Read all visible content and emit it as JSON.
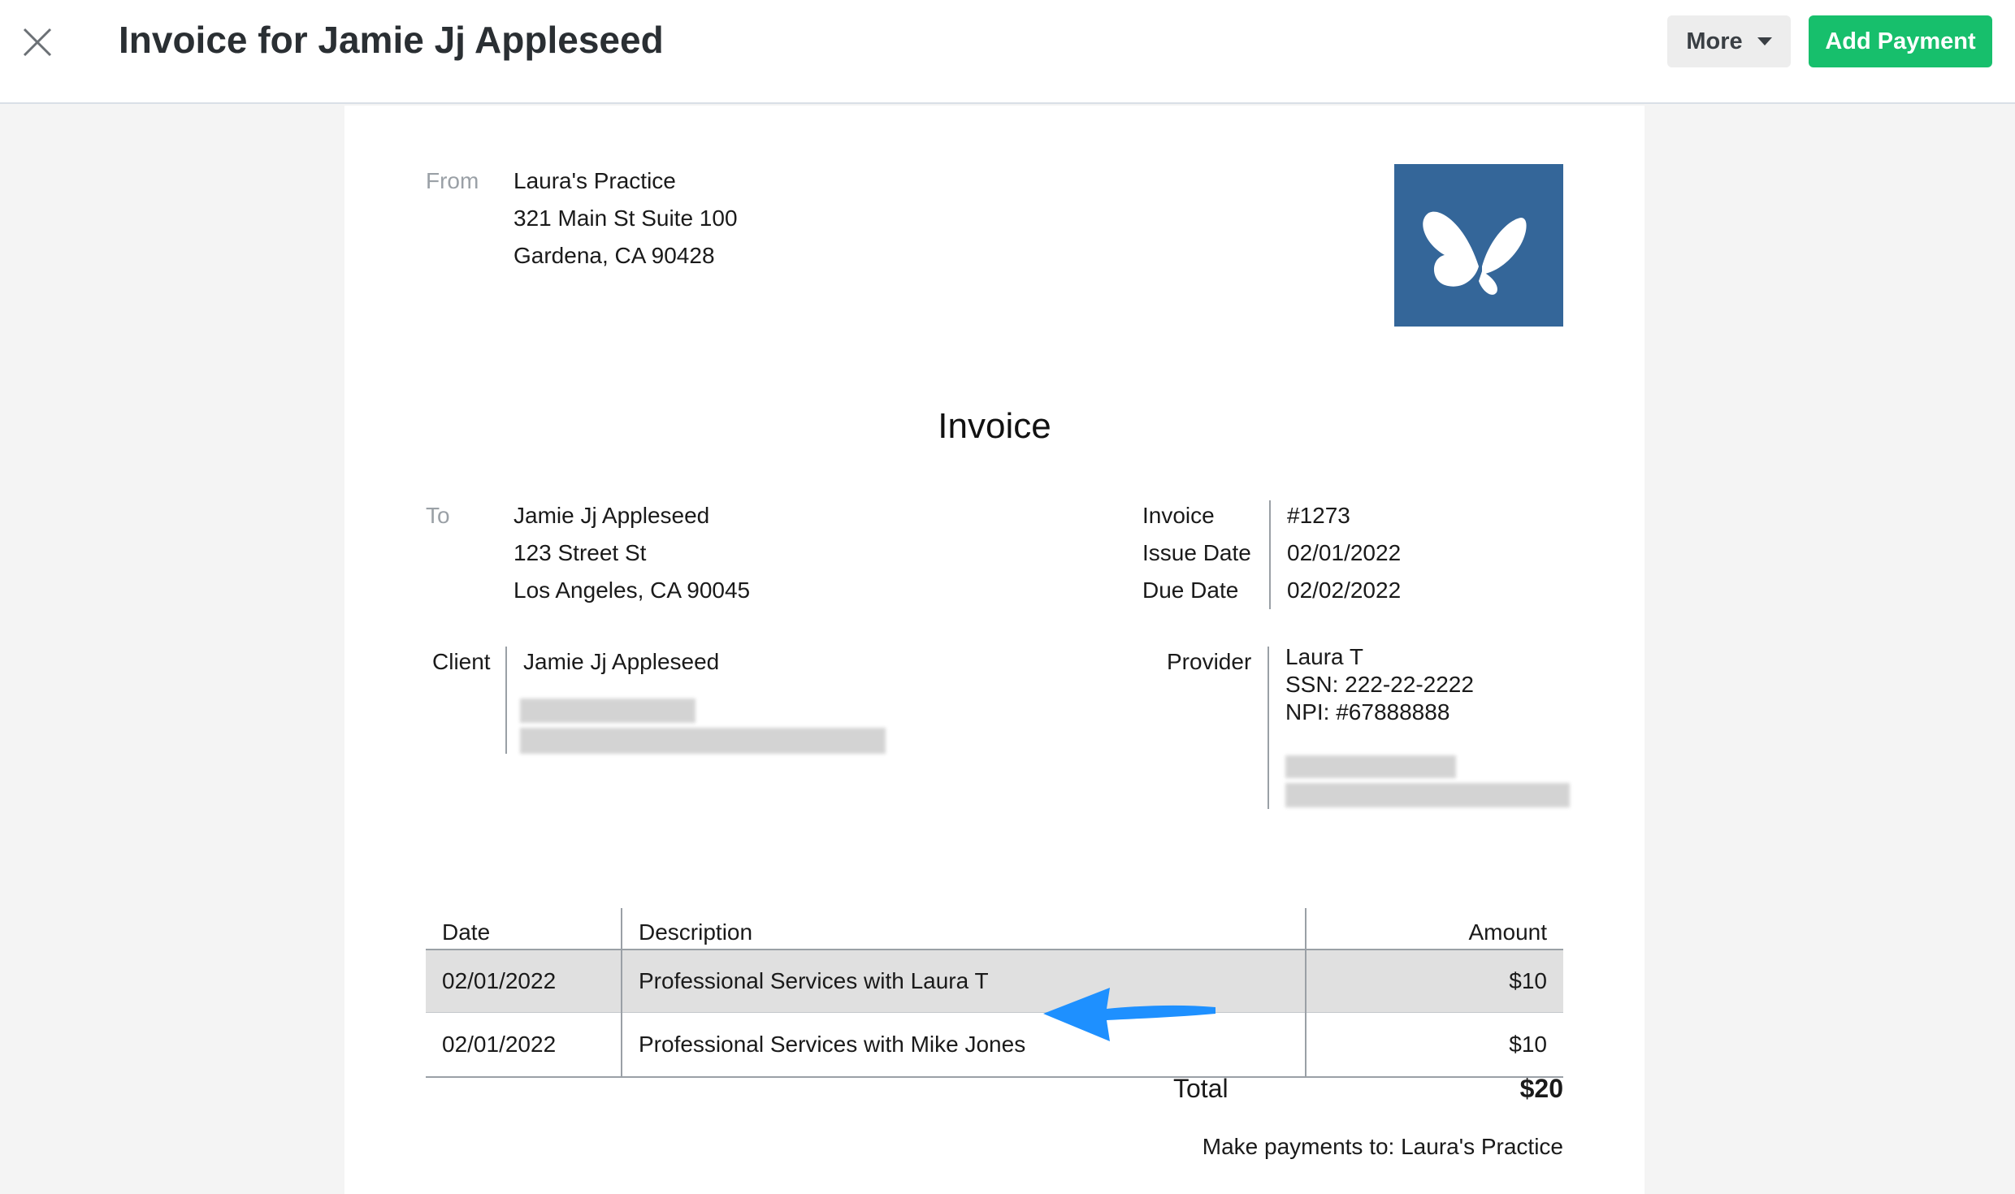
{
  "header": {
    "title": "Invoice for Jamie Jj Appleseed",
    "more_label": "More",
    "add_payment_label": "Add Payment",
    "accent_color": "#17bf6c"
  },
  "from": {
    "label": "From",
    "lines": [
      "Laura's Practice",
      "321 Main St Suite 100",
      "Gardena, CA 90428"
    ]
  },
  "logo": {
    "icon": "butterfly-icon",
    "background": "#346699"
  },
  "invoice_heading": "Invoice",
  "to": {
    "label": "To",
    "lines": [
      "Jamie Jj Appleseed",
      "123 Street St",
      "Los Angeles, CA 90045"
    ]
  },
  "meta": {
    "rows": [
      {
        "label": "Invoice",
        "value": "#1273"
      },
      {
        "label": "Issue Date",
        "value": "02/01/2022"
      },
      {
        "label": "Due Date",
        "value": "02/02/2022"
      }
    ]
  },
  "client": {
    "label": "Client",
    "name": "Jamie Jj Appleseed"
  },
  "provider": {
    "label": "Provider",
    "lines": [
      "Laura T",
      "SSN: 222-22-2222",
      "NPI: #67888888"
    ]
  },
  "table": {
    "headers": {
      "date": "Date",
      "description": "Description",
      "amount": "Amount"
    },
    "rows": [
      {
        "date": "02/01/2022",
        "description": "Professional Services with Laura T",
        "amount": "$10"
      },
      {
        "date": "02/01/2022",
        "description": "Professional Services with Mike Jones",
        "amount": "$10"
      }
    ]
  },
  "total": {
    "label": "Total",
    "value": "$20"
  },
  "payment_note": "Make payments to: Laura's Practice"
}
